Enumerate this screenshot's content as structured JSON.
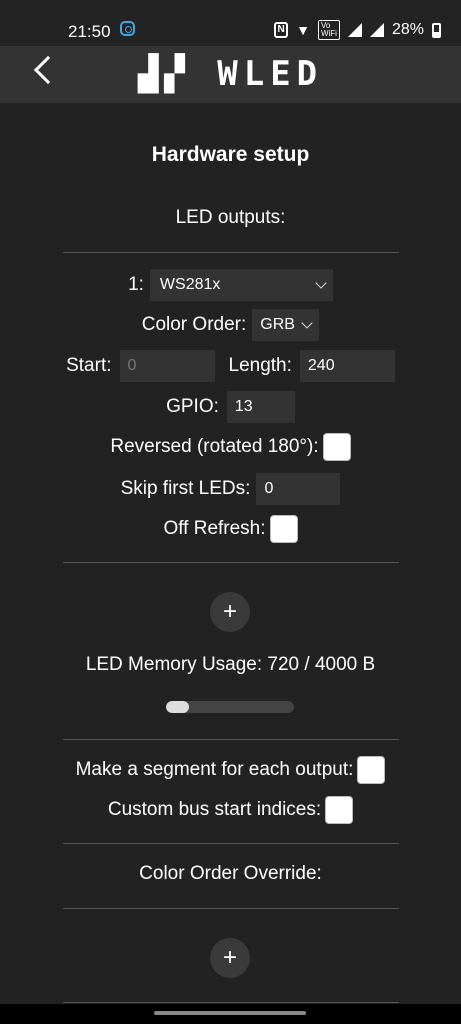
{
  "status": {
    "time": "21:50",
    "battery": "28%",
    "volte_top": "Vo",
    "volte_bottom": "WiFi",
    "nfc": "N"
  },
  "header": {
    "logo": "WLED"
  },
  "page": {
    "title": "Hardware setup",
    "led_outputs_label": "LED outputs:",
    "output": {
      "index": "1:",
      "type": "WS281x",
      "color_order_label": "Color Order:",
      "color_order": "GRB",
      "start_label": "Start:",
      "start_value": "0",
      "length_label": "Length:",
      "length_value": "240",
      "gpio_label": "GPIO:",
      "gpio_value": "13",
      "reversed_label": "Reversed (rotated 180°):",
      "skip_label": "Skip first LEDs:",
      "skip_value": "0",
      "off_refresh_label": "Off Refresh:"
    },
    "add_output": "+",
    "memory_usage": "LED Memory Usage: 720 / 4000 B",
    "memory_fraction": 0.18,
    "segment_each_label": "Make a segment for each output:",
    "custom_bus_label": "Custom bus start indices:",
    "color_order_override_label": "Color Order Override:",
    "add_override": "+"
  }
}
